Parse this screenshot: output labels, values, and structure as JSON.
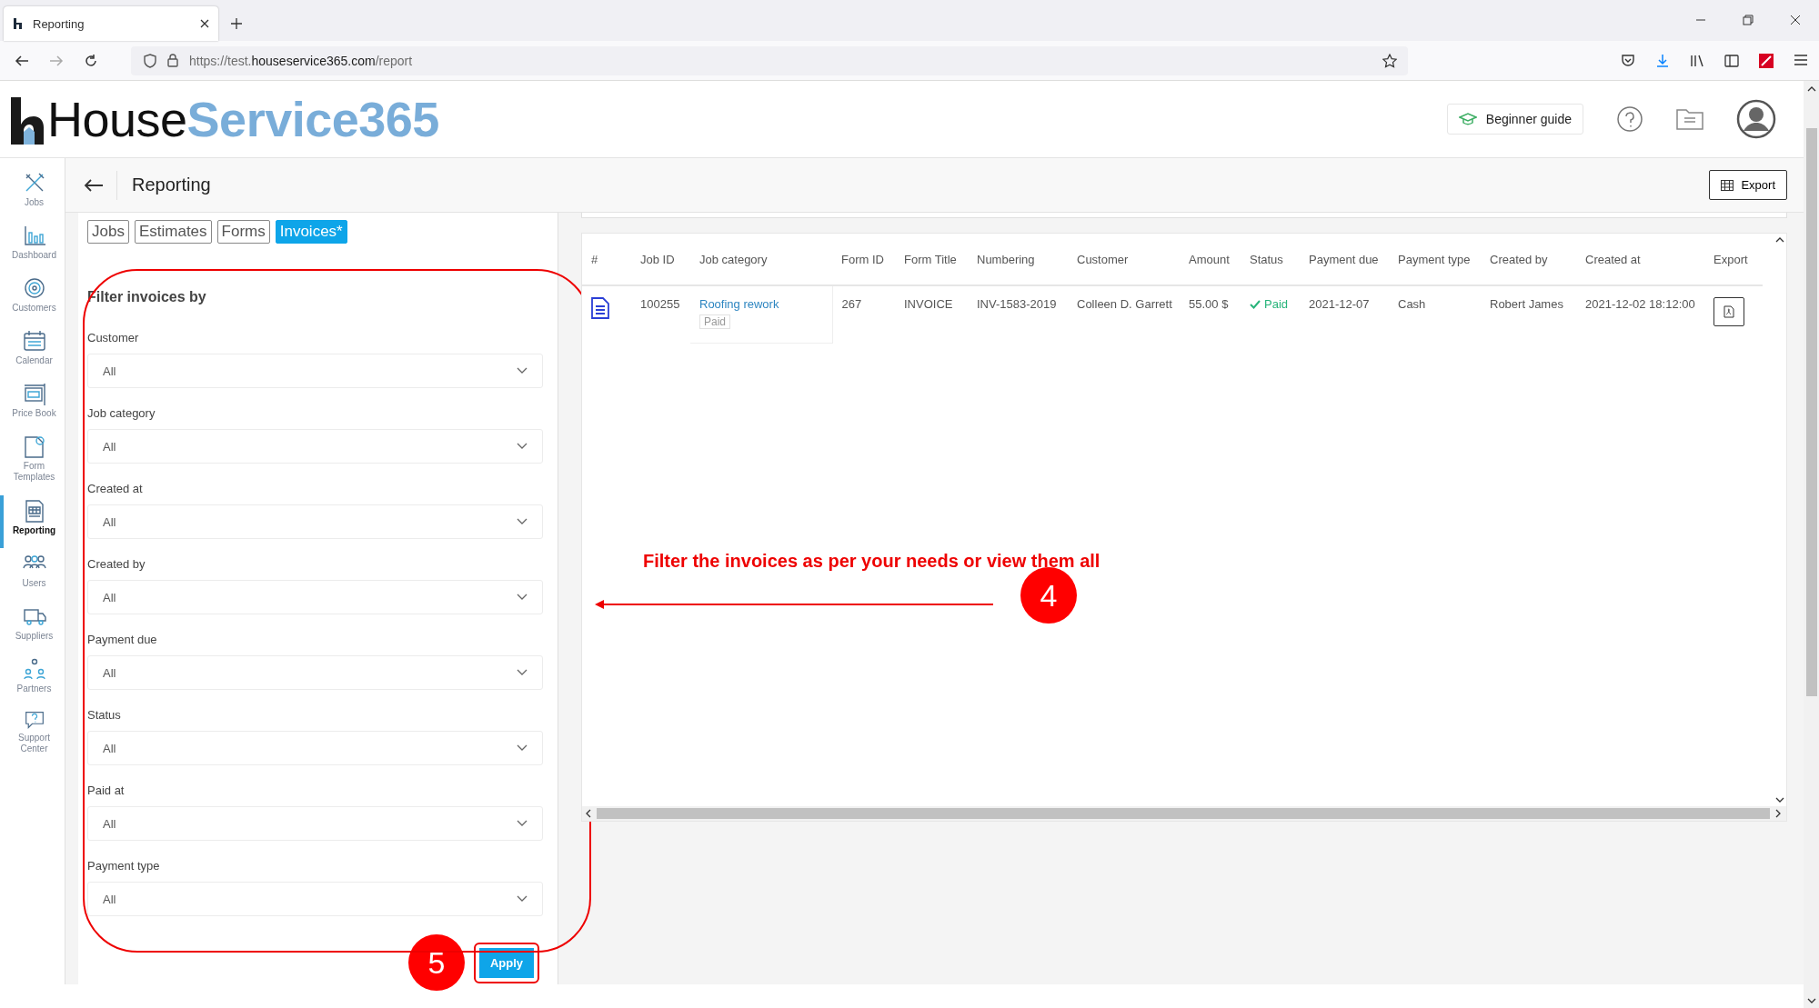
{
  "browser": {
    "tab_title": "Reporting",
    "url": {
      "scheme": "https://test.",
      "domain": "houseservice365.com",
      "path": "/report"
    }
  },
  "app_header": {
    "logo": {
      "dark": "House",
      "light": "Service365"
    },
    "guide_button": "Beginner guide"
  },
  "sidebar": {
    "items": [
      {
        "label": "Jobs",
        "selected": false
      },
      {
        "label": "Dashboard",
        "selected": false
      },
      {
        "label": "Customers",
        "selected": false
      },
      {
        "label": "Calendar",
        "selected": false
      },
      {
        "label": "Price Book",
        "selected": false
      },
      {
        "label": "Form Templates",
        "selected": false
      },
      {
        "label": "Reporting",
        "selected": true
      },
      {
        "label": "Users",
        "selected": false
      },
      {
        "label": "Suppliers",
        "selected": false
      },
      {
        "label": "Partners",
        "selected": false
      },
      {
        "label": "Support Center",
        "selected": false
      }
    ]
  },
  "page_header": {
    "title": "Reporting",
    "export_button": "Export"
  },
  "report_tabs": [
    {
      "label": "Jobs",
      "selected": false
    },
    {
      "label": "Estimates",
      "selected": false
    },
    {
      "label": "Forms",
      "selected": false
    },
    {
      "label": "Invoices*",
      "selected": true
    }
  ],
  "filter_panel": {
    "title": "Filter invoices by",
    "filters": [
      {
        "label": "Customer",
        "value": "All"
      },
      {
        "label": "Job category",
        "value": "All"
      },
      {
        "label": "Created at",
        "value": "All"
      },
      {
        "label": "Created by",
        "value": "All"
      },
      {
        "label": "Payment due",
        "value": "All"
      },
      {
        "label": "Status",
        "value": "All"
      },
      {
        "label": "Paid at",
        "value": "All"
      },
      {
        "label": "Payment type",
        "value": "All"
      }
    ],
    "apply_button": "Apply"
  },
  "table": {
    "columns": [
      "#",
      "Job ID",
      "Job category",
      "Form ID",
      "Form Title",
      "Numbering",
      "Customer",
      "Amount",
      "Status",
      "Payment due",
      "Payment type",
      "Created by",
      "Created at",
      "Export"
    ],
    "rows": [
      {
        "job_id": "100255",
        "job_category": "Roofing rework",
        "category_badge": "Paid",
        "form_id": "267",
        "form_title": "INVOICE",
        "numbering": "INV-1583-2019",
        "customer": "Colleen D. Garrett",
        "amount": "55.00 $",
        "status": {
          "text": "Paid",
          "kind": "paid"
        },
        "payment_due": "2021-12-07",
        "payment_type": "Cash",
        "created_by": "Robert James",
        "created_at": "2021-12-02 18:12:00"
      }
    ]
  },
  "annotations": [
    {
      "kind": "callout",
      "text": "Filter the invoices as per your needs or view them all",
      "number": "4"
    },
    {
      "kind": "step",
      "number": "5"
    }
  ]
}
